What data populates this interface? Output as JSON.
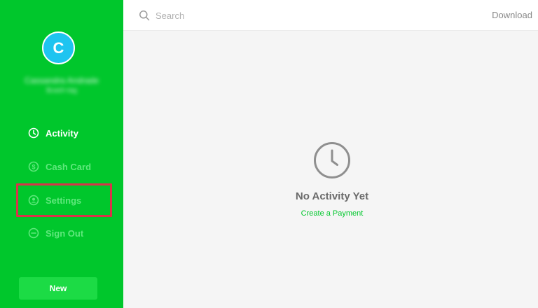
{
  "user": {
    "avatar_initial": "C",
    "name": "Cassandra Andrade",
    "tag": "$cash-tag"
  },
  "nav": {
    "activity": "Activity",
    "cash_card": "Cash Card",
    "settings": "Settings",
    "sign_out": "Sign Out"
  },
  "new_button": "New",
  "search": {
    "placeholder": "Search"
  },
  "download": "Download",
  "empty_state": {
    "title": "No Activity Yet",
    "link": "Create a Payment"
  },
  "colors": {
    "brand_green": "#00c72c",
    "avatar_blue": "#1ec4f0",
    "highlight_red": "#d9334a"
  },
  "icons": {
    "activity": "clock-icon",
    "cash_card": "dollar-circle-icon",
    "settings": "user-circle-icon",
    "sign_out": "minus-circle-icon",
    "search": "search-icon"
  }
}
